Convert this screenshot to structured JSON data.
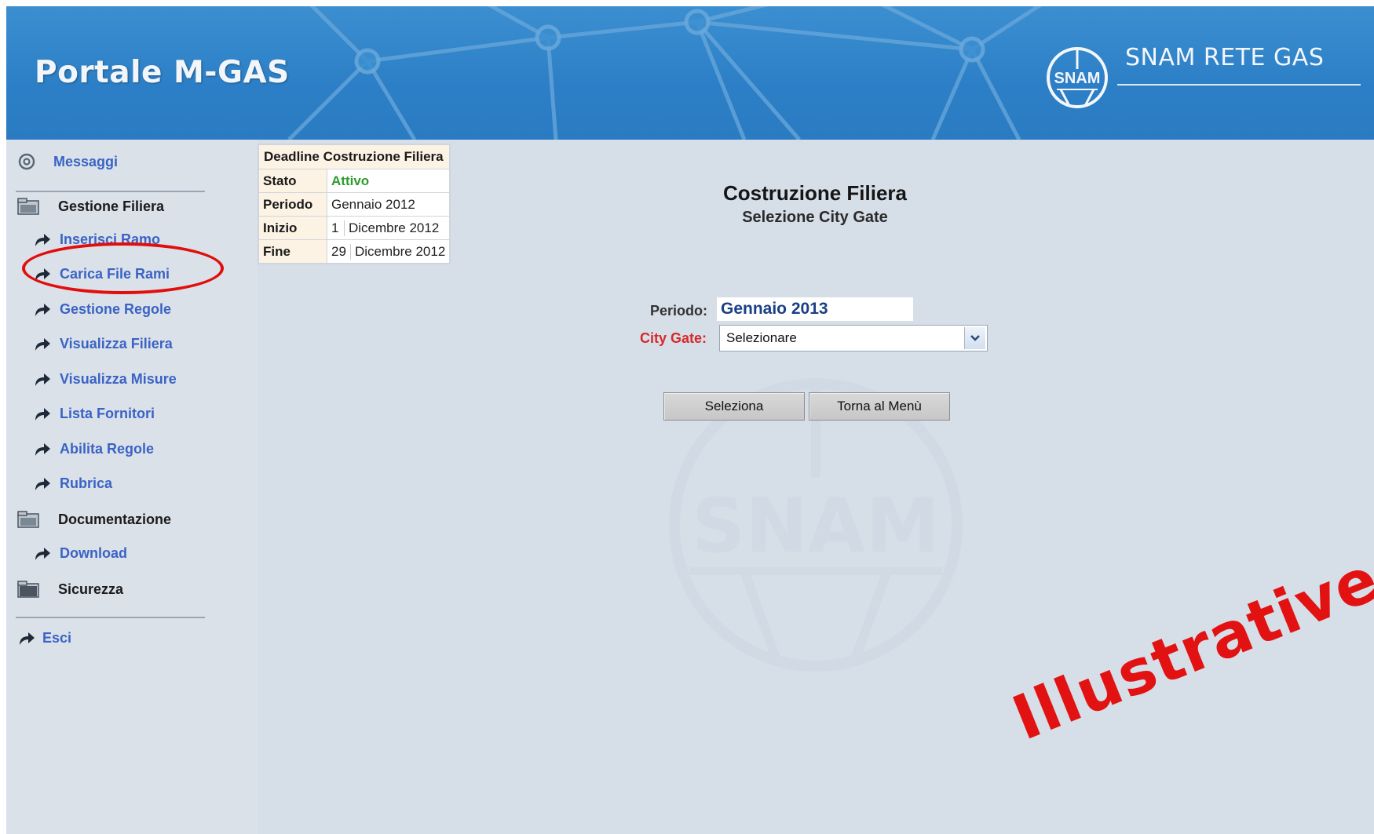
{
  "header": {
    "app_title": "Portale M-GAS",
    "brand_logo_text": "SNAM",
    "brand_name": "SNAM RETE GAS"
  },
  "sidebar": {
    "top_item": {
      "label": "Messaggi",
      "icon": "at-icon"
    },
    "groups": [
      {
        "label": "Gestione Filiera",
        "icon": "folder-icon",
        "items": [
          {
            "label": "Inserisci Ramo",
            "icon": "arrow-curve-icon"
          },
          {
            "label": "Carica File Rami",
            "icon": "arrow-curve-icon"
          },
          {
            "label": "Gestione Regole",
            "icon": "arrow-curve-icon"
          },
          {
            "label": "Visualizza Filiera",
            "icon": "arrow-curve-icon"
          },
          {
            "label": "Visualizza Misure",
            "icon": "arrow-curve-icon"
          },
          {
            "label": "Lista Fornitori",
            "icon": "arrow-curve-icon"
          },
          {
            "label": "Abilita Regole",
            "icon": "arrow-curve-icon"
          },
          {
            "label": "Rubrica",
            "icon": "arrow-curve-icon"
          }
        ]
      },
      {
        "label": "Documentazione",
        "icon": "folder-icon",
        "items": [
          {
            "label": "Download",
            "icon": "arrow-curve-icon"
          }
        ]
      },
      {
        "label": "Sicurezza",
        "icon": "folder-icon",
        "items": []
      }
    ],
    "exit_item": {
      "label": "Esci",
      "icon": "arrow-curve-icon"
    }
  },
  "deadline": {
    "title": "Deadline Costruzione Filiera",
    "rows": [
      {
        "key": "Stato",
        "value": "Attivo",
        "value_color": "#2e9a2e"
      },
      {
        "key": "Periodo",
        "value": "Gennaio 2012"
      },
      {
        "key": "Inizio",
        "day": "1",
        "month_year": "Dicembre 2012"
      },
      {
        "key": "Fine",
        "day": "29",
        "month_year": "Dicembre 2012"
      }
    ]
  },
  "main": {
    "title": "Costruzione Filiera",
    "subtitle": "Selezione City Gate",
    "periodo_label": "Periodo:",
    "periodo_value": "Gennaio 2013",
    "city_gate_label": "City Gate:",
    "city_gate_selected": "Selezionare",
    "buttons": {
      "select": "Seleziona",
      "back": "Torna al Menù"
    },
    "watermark_text": "SNAM"
  },
  "overlay": {
    "stamp_text": "Illustrative",
    "highlight_color": "#e20d0d"
  },
  "colors": {
    "header_blue": "#2c7fc6",
    "page_bg": "#d6dee8",
    "link_blue": "#3a63c4",
    "required_red": "#d62a2a"
  }
}
